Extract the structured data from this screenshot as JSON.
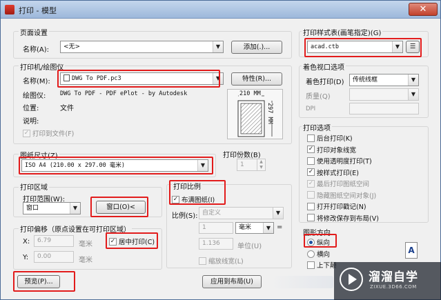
{
  "title": "打印 - 模型",
  "close_label": "✕",
  "page_setup": {
    "group_title": "页面设置",
    "name_label": "名称(A):",
    "name_value": "<无>",
    "add_button": "添加(.)..."
  },
  "printer": {
    "group_title": "打印机/绘图仪",
    "name_label": "名称(M):",
    "name_value": "DWG To PDF.pc3",
    "properties_button": "特性(R)...",
    "plotter_label": "绘图仪:",
    "plotter_value": "DWG To PDF - PDF ePlot - by Autodesk",
    "location_label": "位置:",
    "location_value": "文件",
    "description_label": "说明:",
    "print_to_file": "打印到文件(F)",
    "paper_width": "210 MM",
    "paper_height": "297 MM"
  },
  "paper_size": {
    "group_title": "图纸尺寸(Z)",
    "value": "ISO A4 (210.00 x 297.00 毫米)"
  },
  "copies": {
    "label": "打印份数(B)",
    "value": "1"
  },
  "plot_area": {
    "group_title": "打印区域",
    "range_label": "打印范围(W):",
    "range_value": "窗口",
    "window_button": "窗口(O)<"
  },
  "plot_offset": {
    "group_title": "打印偏移（原点设置在可打印区域）",
    "x_label": "X:",
    "x_value": "6.79",
    "y_label": "Y:",
    "y_value": "0.00",
    "unit": "毫米",
    "center_plot": "居中打印(C)"
  },
  "plot_scale": {
    "group_title": "打印比例",
    "fit_to_paper": "布满图纸(I)",
    "scale_label": "比例(S):",
    "scale_value": "自定义",
    "value1": "1",
    "unit1": "毫米",
    "equals": "=",
    "value2": "1.136",
    "unit2": "单位(U)",
    "scale_lineweights": "缩放线宽(L)"
  },
  "plot_style": {
    "group_title": "打印样式表(画笔指定)(G)",
    "value": "acad.ctb"
  },
  "shaded_viewport": {
    "group_title": "着色视口选项",
    "shade_label": "着色打印(D)",
    "shade_value": "传统线框",
    "quality_label": "质量(Q)",
    "dpi_label": "DPI"
  },
  "plot_options": {
    "group_title": "打印选项",
    "items": [
      {
        "label": "后台打印(K)",
        "checked": false,
        "enabled": true
      },
      {
        "label": "打印对象线宽",
        "checked": true,
        "enabled": true
      },
      {
        "label": "使用透明度打印(T)",
        "checked": false,
        "enabled": true
      },
      {
        "label": "按样式打印(E)",
        "checked": true,
        "enabled": true
      },
      {
        "label": "最后打印图纸空间",
        "checked": true,
        "enabled": false
      },
      {
        "label": "隐藏图纸空间对象(J)",
        "checked": false,
        "enabled": false
      },
      {
        "label": "打开打印戳记(N)",
        "checked": false,
        "enabled": true
      },
      {
        "label": "将修改保存到布局(V)",
        "checked": false,
        "enabled": true
      }
    ]
  },
  "orientation": {
    "group_title": "图形方向",
    "portrait": "纵向",
    "landscape": "横向",
    "upside_down": "上下颠",
    "selected": "portrait"
  },
  "footer": {
    "preview_button": "预览(P)...",
    "apply_button": "应用到布局(U)"
  },
  "watermark": {
    "text": "溜溜自学",
    "sub": "ZIXUE.3D66.COM"
  },
  "colors": {
    "highlight": "#e21b1b",
    "title_bar": "#9db8db"
  }
}
